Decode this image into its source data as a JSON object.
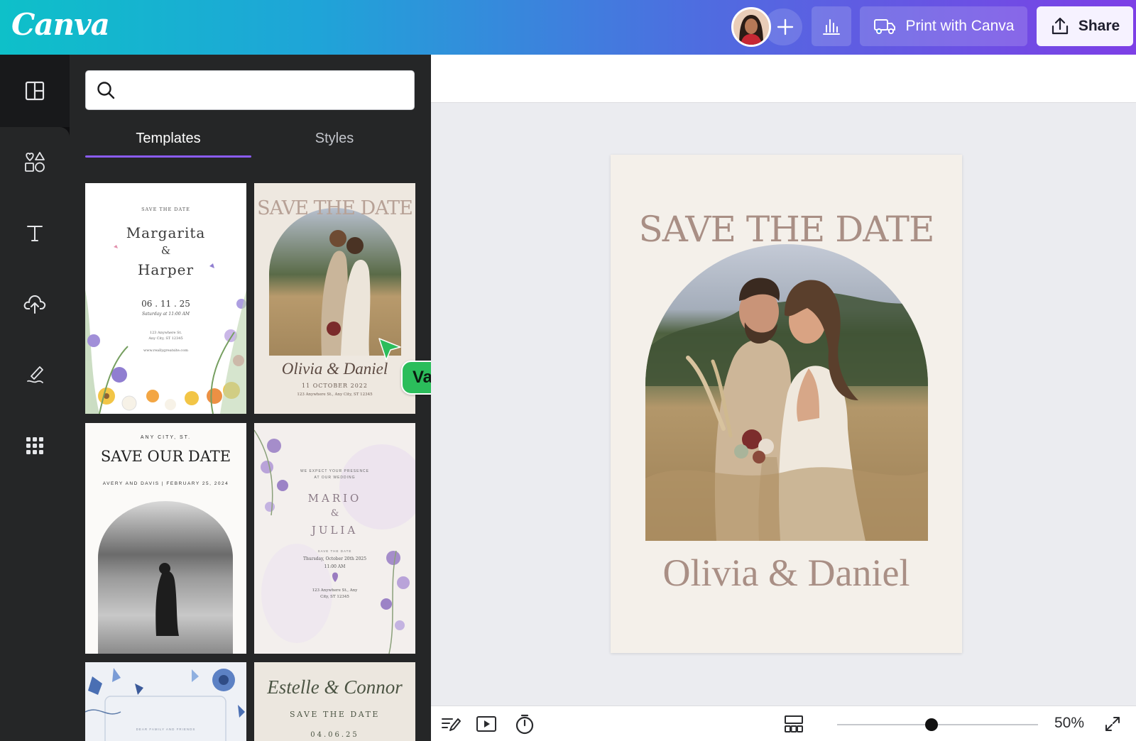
{
  "app": {
    "logo_text": "Canva"
  },
  "topbar": {
    "print_label": "Print with Canva",
    "share_label": "Share"
  },
  "side_panel": {
    "search": {
      "placeholder": "",
      "value": ""
    },
    "tabs": [
      {
        "label": "Templates",
        "active": true
      },
      {
        "label": "Styles",
        "active": false
      }
    ],
    "templates": [
      {
        "kicker": "SAVE THE DATE",
        "name_1": "Margarita",
        "amp": "&",
        "name_2": "Harper",
        "date": "06 . 11 . 25",
        "time": "Saturday at 11:00 AM",
        "address_1": "123 Anywhere St.",
        "address_2": "Any City, ST 12345",
        "website": "www.reallygreatsite.com"
      },
      {
        "title": "SAVE THE DATE",
        "names": "Olivia & Daniel",
        "date": "11 OCTOBER 2022",
        "address": "123 Anywhere St., Any City, ST 12345"
      },
      {
        "kicker": "ANY CITY, ST.",
        "title": "SAVE OUR DATE",
        "arc_text": "AVERY AND DAVIS | FEBRUARY 25, 2024"
      },
      {
        "intro_1": "WE EXPECT YOUR PRESENCE",
        "intro_2": "AT OUR WEDDING",
        "name_1": "MARIO",
        "amp": "&",
        "name_2": "JULIA",
        "kicker": "SAVE THE DATE",
        "date": "Thursday, October 20th 2025",
        "time": "11:00 AM",
        "address_1": "123 Anywhere St., Any",
        "address_2": "City, ST 12345"
      },
      {
        "caption": "DEAR FAMILY AND FRIENDS"
      },
      {
        "names": "Estelle & Connor",
        "kicker": "SAVE THE DATE",
        "date": "04.06.25"
      }
    ]
  },
  "collaborator": {
    "name": "Valerie",
    "color": "#2bbd5b"
  },
  "canvas": {
    "page": {
      "title": "SAVE THE DATE",
      "names": "Olivia & Daniel"
    },
    "colors": {
      "text": "#a98f85",
      "background": "#f4f0ea"
    }
  },
  "bottombar": {
    "zoom_label": "50%",
    "zoom_fraction": 0.47
  },
  "icons": [
    "design-panel-icon",
    "elements-icon",
    "text-icon",
    "uploads-icon",
    "draw-icon",
    "apps-icon",
    "search-icon",
    "plus-icon",
    "insights-icon",
    "print-truck-icon",
    "share-upload-icon",
    "notes-icon",
    "present-icon",
    "timer-icon",
    "pages-grid-icon",
    "fullscreen-icon"
  ]
}
